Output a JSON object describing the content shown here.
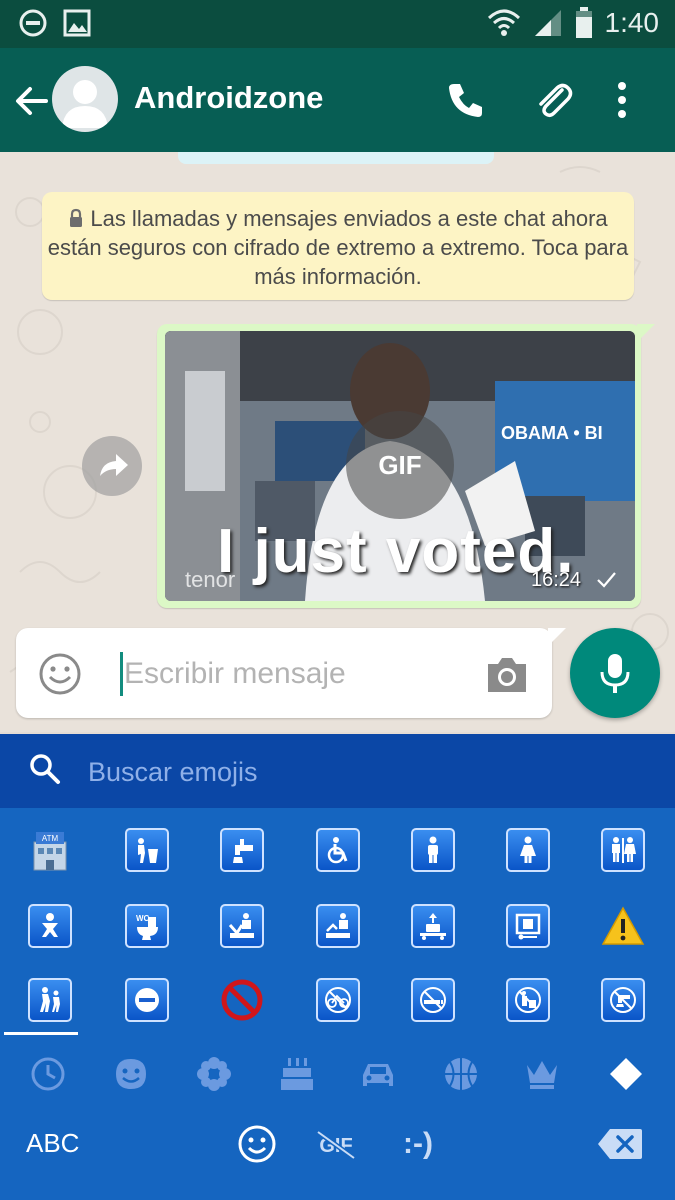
{
  "status_bar": {
    "time": "1:40"
  },
  "app_bar": {
    "contact_name": "Androidzone"
  },
  "chat": {
    "encryption_notice": "Las llamadas y mensajes enviados a este chat ahora están seguros con cifrado de extremo a extremo. Toca para más información.",
    "message": {
      "gif_badge": "GIF",
      "caption": "I just voted.",
      "watermark": "tenor",
      "banner_text": "OBAMA • BI",
      "time": "16:24"
    }
  },
  "composer": {
    "placeholder": "Escribir mensaje"
  },
  "keyboard": {
    "search_placeholder": "Buscar emojis",
    "emoji_rows": [
      [
        "atm",
        "litter-bin",
        "potable-water",
        "wheelchair",
        "mens-room",
        "womens-room",
        "restroom"
      ],
      [
        "baby-symbol",
        "water-closet",
        "passport-control",
        "customs",
        "baggage-claim",
        "left-luggage",
        "warning"
      ],
      [
        "children-crossing",
        "no-entry",
        "prohibited",
        "no-bicycles",
        "no-smoking",
        "do-not-litter",
        "non-potable-water"
      ]
    ],
    "category_tabs": [
      "recent",
      "smileys",
      "nature",
      "food",
      "travel",
      "activity",
      "objects",
      "symbols"
    ],
    "bottom": {
      "abc_label": "ABC",
      "gif_label": "GIF",
      "emoticon_label": ":-)"
    }
  },
  "colors": {
    "app_bar": "#075e54",
    "status_bar": "#0b4d3f",
    "notice_bg": "#fdf4c5",
    "bubble_out": "#dcf8c6",
    "mic_button": "#00897b",
    "keyboard_bg": "#1565c0",
    "keyboard_search_bg": "#0b47a6"
  }
}
